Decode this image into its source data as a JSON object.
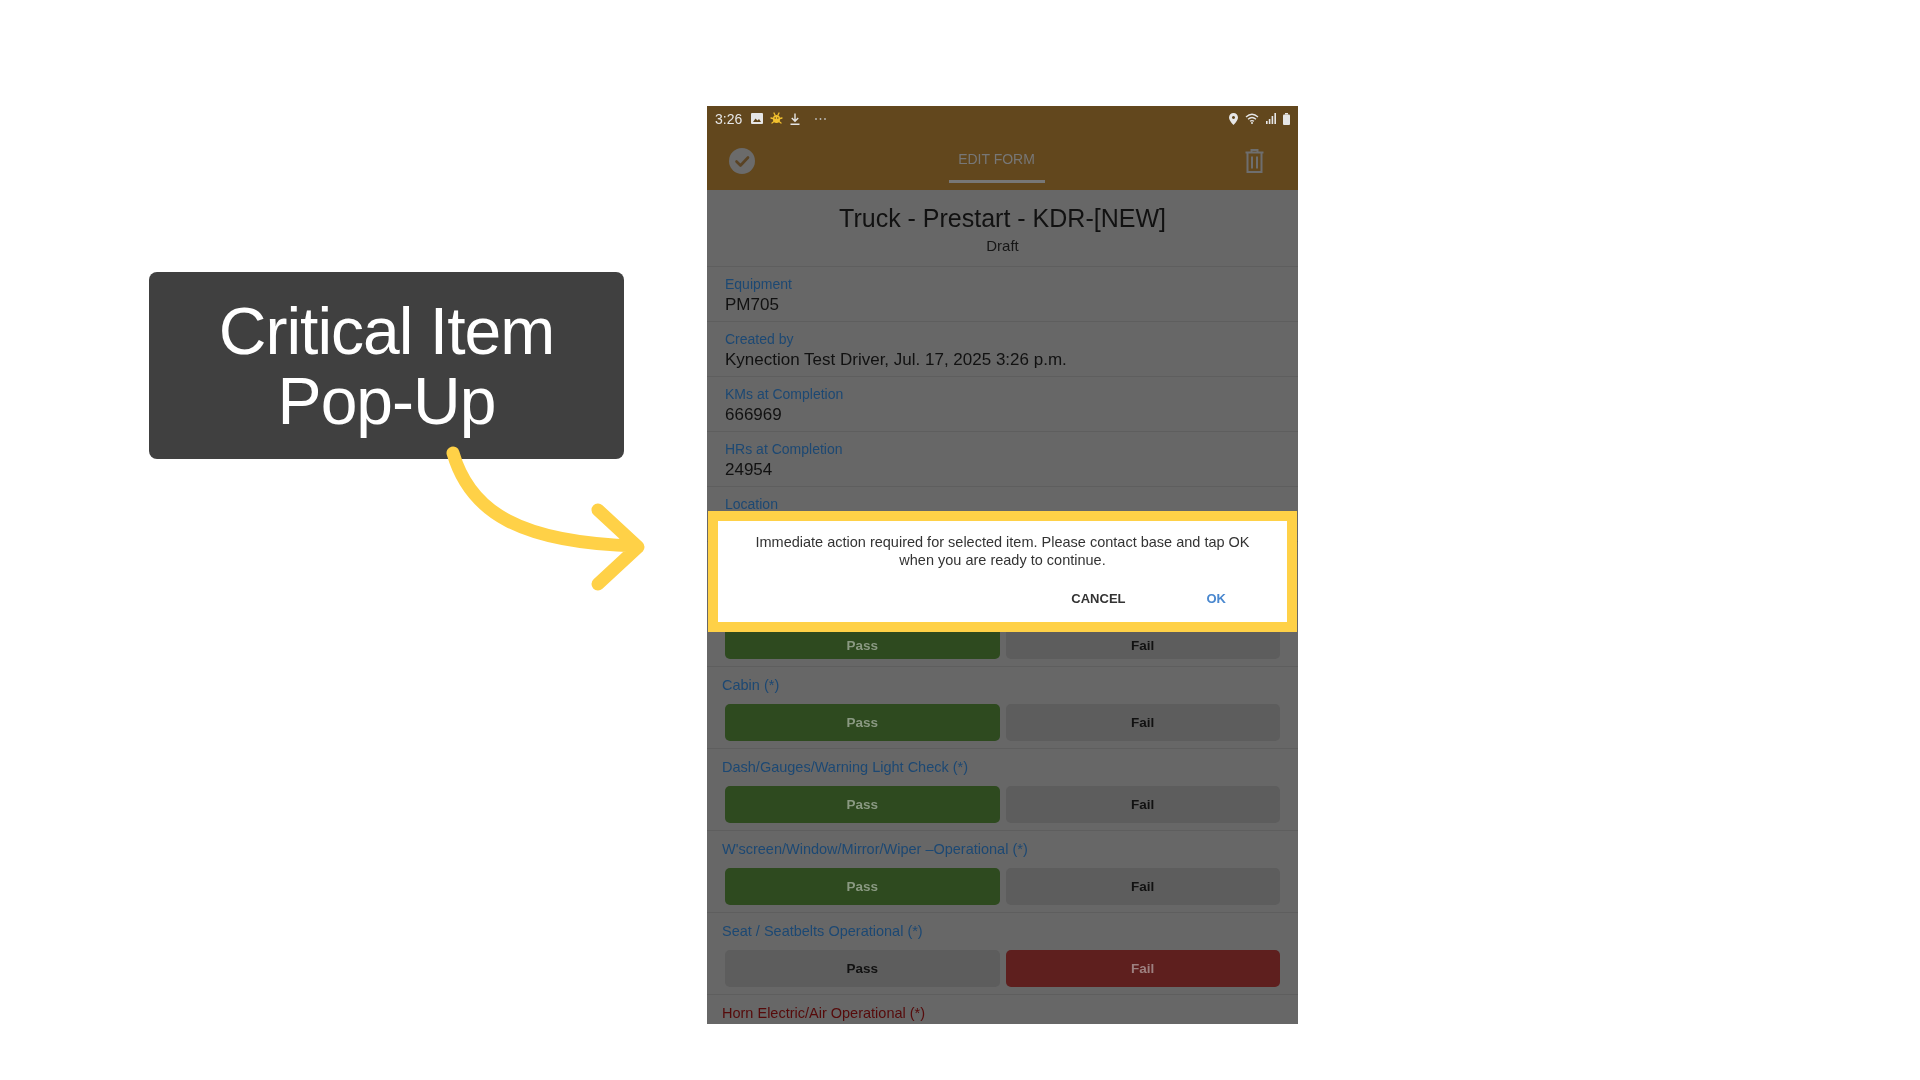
{
  "callout": {
    "text": "Critical Item Pop-Up"
  },
  "status_bar": {
    "time": "3:26"
  },
  "toolbar": {
    "tab": {
      "label": "EDIT FORM",
      "selected": true
    }
  },
  "form": {
    "title": "Truck - Prestart - KDR-[NEW]",
    "status": "Draft",
    "fields": [
      {
        "label": "Equipment",
        "value": "PM705"
      },
      {
        "label": "Created by",
        "value": "Kynection Test Driver, Jul. 17, 2025 3:26 p.m."
      },
      {
        "label": "KMs at Completion",
        "value": "666969"
      },
      {
        "label": "HRs at Completion",
        "value": "24954"
      },
      {
        "label": "Location"
      }
    ],
    "checks": [
      {
        "options": [
          {
            "label": "Pass",
            "kind": "pass",
            "selected": true
          },
          {
            "label": "Fail",
            "kind": "fail",
            "selected": false
          }
        ]
      },
      {
        "label": "Cabin (*)",
        "error": false,
        "options": [
          {
            "label": "Pass",
            "kind": "pass",
            "selected": true
          },
          {
            "label": "Fail",
            "kind": "fail",
            "selected": false
          }
        ]
      },
      {
        "label": "Dash/Gauges/Warning Light Check (*)",
        "error": false,
        "options": [
          {
            "label": "Pass",
            "kind": "pass",
            "selected": true
          },
          {
            "label": "Fail",
            "kind": "fail",
            "selected": false
          }
        ]
      },
      {
        "label": "W'screen/Window/Mirror/Wiper –Operational (*)",
        "error": false,
        "options": [
          {
            "label": "Pass",
            "kind": "pass",
            "selected": true
          },
          {
            "label": "Fail",
            "kind": "fail",
            "selected": false
          }
        ]
      },
      {
        "label": "Seat / Seatbelts Operational (*)",
        "error": false,
        "options": [
          {
            "label": "Pass",
            "kind": "pass",
            "selected": false
          },
          {
            "label": "Fail",
            "kind": "fail",
            "selected": true
          }
        ]
      },
      {
        "label": "Horn Electric/Air Operational (*)",
        "error": true
      }
    ]
  },
  "dialog": {
    "message": "Immediate action required for selected item. Please contact base and tap OK when you are ready to continue.",
    "buttons": [
      {
        "label": "CANCEL",
        "kind": "neutral"
      },
      {
        "label": "OK",
        "kind": "primary"
      }
    ]
  }
}
